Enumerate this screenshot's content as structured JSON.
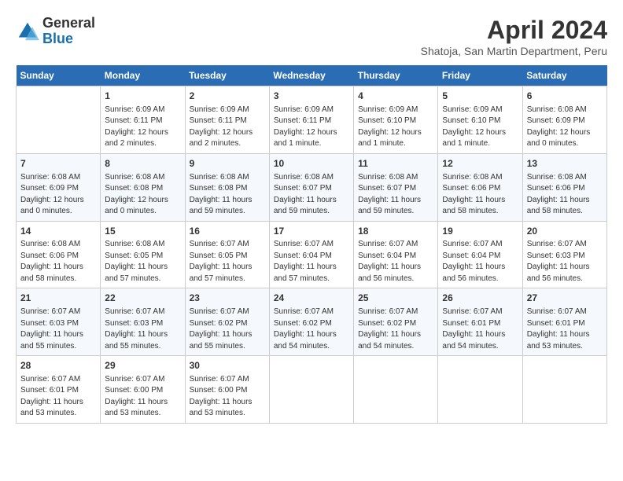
{
  "logo": {
    "general": "General",
    "blue": "Blue"
  },
  "title": "April 2024",
  "location": "Shatoja, San Martin Department, Peru",
  "days_of_week": [
    "Sunday",
    "Monday",
    "Tuesday",
    "Wednesday",
    "Thursday",
    "Friday",
    "Saturday"
  ],
  "weeks": [
    [
      {
        "day": "",
        "sunrise": "",
        "sunset": "",
        "daylight": ""
      },
      {
        "day": "1",
        "sunrise": "Sunrise: 6:09 AM",
        "sunset": "Sunset: 6:11 PM",
        "daylight": "Daylight: 12 hours and 2 minutes."
      },
      {
        "day": "2",
        "sunrise": "Sunrise: 6:09 AM",
        "sunset": "Sunset: 6:11 PM",
        "daylight": "Daylight: 12 hours and 2 minutes."
      },
      {
        "day": "3",
        "sunrise": "Sunrise: 6:09 AM",
        "sunset": "Sunset: 6:11 PM",
        "daylight": "Daylight: 12 hours and 1 minute."
      },
      {
        "day": "4",
        "sunrise": "Sunrise: 6:09 AM",
        "sunset": "Sunset: 6:10 PM",
        "daylight": "Daylight: 12 hours and 1 minute."
      },
      {
        "day": "5",
        "sunrise": "Sunrise: 6:09 AM",
        "sunset": "Sunset: 6:10 PM",
        "daylight": "Daylight: 12 hours and 1 minute."
      },
      {
        "day": "6",
        "sunrise": "Sunrise: 6:08 AM",
        "sunset": "Sunset: 6:09 PM",
        "daylight": "Daylight: 12 hours and 0 minutes."
      }
    ],
    [
      {
        "day": "7",
        "sunrise": "Sunrise: 6:08 AM",
        "sunset": "Sunset: 6:09 PM",
        "daylight": "Daylight: 12 hours and 0 minutes."
      },
      {
        "day": "8",
        "sunrise": "Sunrise: 6:08 AM",
        "sunset": "Sunset: 6:08 PM",
        "daylight": "Daylight: 12 hours and 0 minutes."
      },
      {
        "day": "9",
        "sunrise": "Sunrise: 6:08 AM",
        "sunset": "Sunset: 6:08 PM",
        "daylight": "Daylight: 11 hours and 59 minutes."
      },
      {
        "day": "10",
        "sunrise": "Sunrise: 6:08 AM",
        "sunset": "Sunset: 6:07 PM",
        "daylight": "Daylight: 11 hours and 59 minutes."
      },
      {
        "day": "11",
        "sunrise": "Sunrise: 6:08 AM",
        "sunset": "Sunset: 6:07 PM",
        "daylight": "Daylight: 11 hours and 59 minutes."
      },
      {
        "day": "12",
        "sunrise": "Sunrise: 6:08 AM",
        "sunset": "Sunset: 6:06 PM",
        "daylight": "Daylight: 11 hours and 58 minutes."
      },
      {
        "day": "13",
        "sunrise": "Sunrise: 6:08 AM",
        "sunset": "Sunset: 6:06 PM",
        "daylight": "Daylight: 11 hours and 58 minutes."
      }
    ],
    [
      {
        "day": "14",
        "sunrise": "Sunrise: 6:08 AM",
        "sunset": "Sunset: 6:06 PM",
        "daylight": "Daylight: 11 hours and 58 minutes."
      },
      {
        "day": "15",
        "sunrise": "Sunrise: 6:08 AM",
        "sunset": "Sunset: 6:05 PM",
        "daylight": "Daylight: 11 hours and 57 minutes."
      },
      {
        "day": "16",
        "sunrise": "Sunrise: 6:07 AM",
        "sunset": "Sunset: 6:05 PM",
        "daylight": "Daylight: 11 hours and 57 minutes."
      },
      {
        "day": "17",
        "sunrise": "Sunrise: 6:07 AM",
        "sunset": "Sunset: 6:04 PM",
        "daylight": "Daylight: 11 hours and 57 minutes."
      },
      {
        "day": "18",
        "sunrise": "Sunrise: 6:07 AM",
        "sunset": "Sunset: 6:04 PM",
        "daylight": "Daylight: 11 hours and 56 minutes."
      },
      {
        "day": "19",
        "sunrise": "Sunrise: 6:07 AM",
        "sunset": "Sunset: 6:04 PM",
        "daylight": "Daylight: 11 hours and 56 minutes."
      },
      {
        "day": "20",
        "sunrise": "Sunrise: 6:07 AM",
        "sunset": "Sunset: 6:03 PM",
        "daylight": "Daylight: 11 hours and 56 minutes."
      }
    ],
    [
      {
        "day": "21",
        "sunrise": "Sunrise: 6:07 AM",
        "sunset": "Sunset: 6:03 PM",
        "daylight": "Daylight: 11 hours and 55 minutes."
      },
      {
        "day": "22",
        "sunrise": "Sunrise: 6:07 AM",
        "sunset": "Sunset: 6:03 PM",
        "daylight": "Daylight: 11 hours and 55 minutes."
      },
      {
        "day": "23",
        "sunrise": "Sunrise: 6:07 AM",
        "sunset": "Sunset: 6:02 PM",
        "daylight": "Daylight: 11 hours and 55 minutes."
      },
      {
        "day": "24",
        "sunrise": "Sunrise: 6:07 AM",
        "sunset": "Sunset: 6:02 PM",
        "daylight": "Daylight: 11 hours and 54 minutes."
      },
      {
        "day": "25",
        "sunrise": "Sunrise: 6:07 AM",
        "sunset": "Sunset: 6:02 PM",
        "daylight": "Daylight: 11 hours and 54 minutes."
      },
      {
        "day": "26",
        "sunrise": "Sunrise: 6:07 AM",
        "sunset": "Sunset: 6:01 PM",
        "daylight": "Daylight: 11 hours and 54 minutes."
      },
      {
        "day": "27",
        "sunrise": "Sunrise: 6:07 AM",
        "sunset": "Sunset: 6:01 PM",
        "daylight": "Daylight: 11 hours and 53 minutes."
      }
    ],
    [
      {
        "day": "28",
        "sunrise": "Sunrise: 6:07 AM",
        "sunset": "Sunset: 6:01 PM",
        "daylight": "Daylight: 11 hours and 53 minutes."
      },
      {
        "day": "29",
        "sunrise": "Sunrise: 6:07 AM",
        "sunset": "Sunset: 6:00 PM",
        "daylight": "Daylight: 11 hours and 53 minutes."
      },
      {
        "day": "30",
        "sunrise": "Sunrise: 6:07 AM",
        "sunset": "Sunset: 6:00 PM",
        "daylight": "Daylight: 11 hours and 53 minutes."
      },
      {
        "day": "",
        "sunrise": "",
        "sunset": "",
        "daylight": ""
      },
      {
        "day": "",
        "sunrise": "",
        "sunset": "",
        "daylight": ""
      },
      {
        "day": "",
        "sunrise": "",
        "sunset": "",
        "daylight": ""
      },
      {
        "day": "",
        "sunrise": "",
        "sunset": "",
        "daylight": ""
      }
    ]
  ]
}
